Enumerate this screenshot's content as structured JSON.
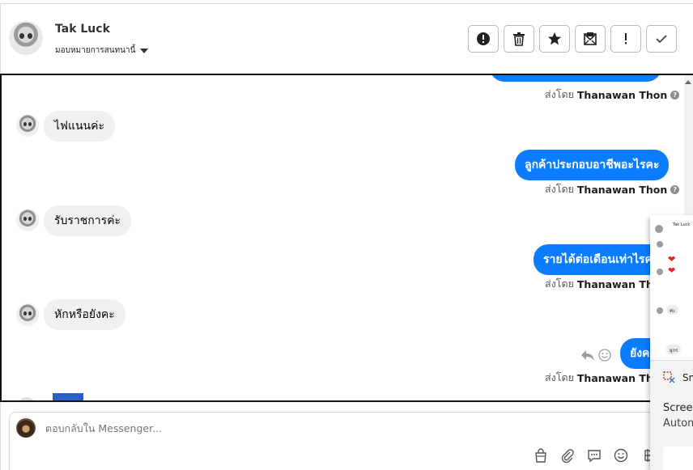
{
  "header": {
    "name": "Tak Luck",
    "assign_label": "มอบหมายการสนทนานี้"
  },
  "actions": [
    {
      "name": "report-spam-button",
      "icon": "alert-circle-icon"
    },
    {
      "name": "delete-button",
      "icon": "trash-icon"
    },
    {
      "name": "star-button",
      "icon": "star-icon"
    },
    {
      "name": "mark-unread-button",
      "icon": "envelope-icon"
    },
    {
      "name": "follow-up-button",
      "icon": "exclamation-icon"
    },
    {
      "name": "mark-done-button",
      "icon": "check-icon"
    }
  ],
  "chat": {
    "sent_by_prefix": "ส่งโดย",
    "agent_name": "Thanawan Thon",
    "help_glyph": "?",
    "messages": [
      {
        "direction": "in",
        "text": "ไฟแนนค่ะ"
      },
      {
        "direction": "out",
        "text": "ลูกค้าประกอบอาชีพอะไรคะ"
      },
      {
        "direction": "in",
        "text": "รับราชการค่ะ"
      },
      {
        "direction": "out",
        "text": "รายได้ต่อเดือนเท่าไรคะ"
      },
      {
        "direction": "in",
        "text": "หักหรือยังคะ"
      },
      {
        "direction": "out",
        "text": "ยังคะ"
      }
    ]
  },
  "composer": {
    "placeholder": "ตอบกลับใน Messenger..."
  },
  "overlay": {
    "mini_name": "Tak Luck",
    "snip_label": "Sn",
    "line1": "Screer",
    "line2": "Autom",
    "bubble1": "ค่ะ",
    "bubble2": "ยุกร"
  },
  "colors": {
    "accent": "#0a7cff",
    "incoming_bubble": "#f0f0f0"
  }
}
